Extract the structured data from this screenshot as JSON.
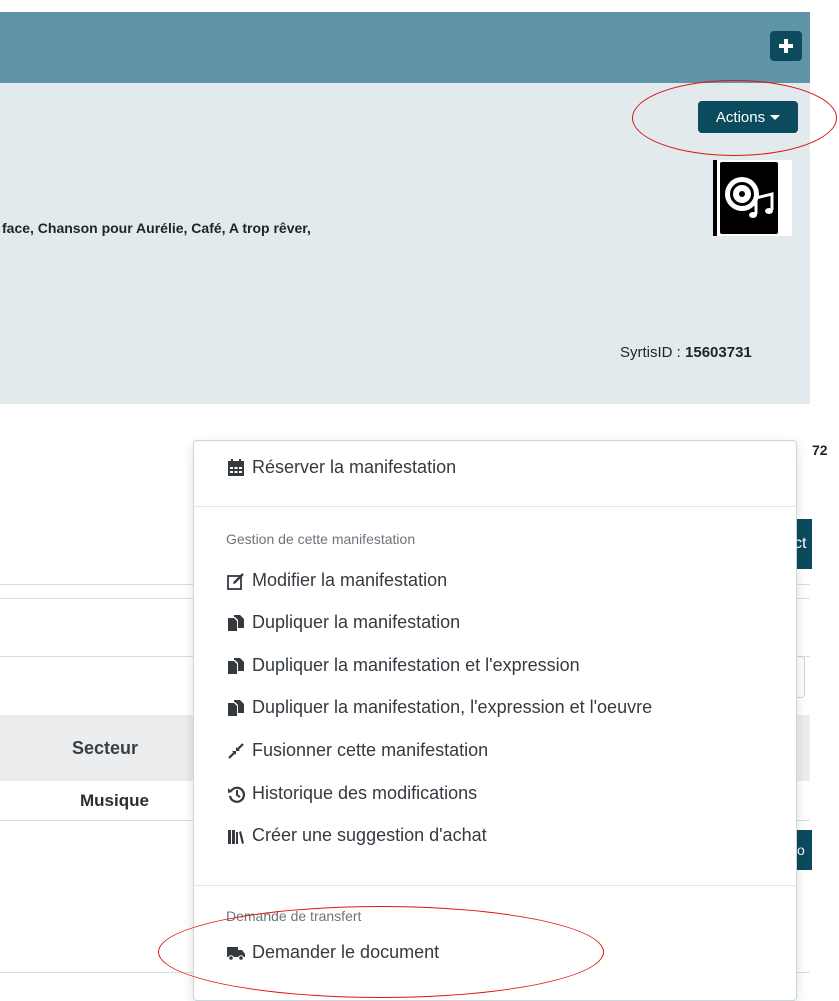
{
  "header": {
    "add_icon": "plus-icon",
    "actions_label": "Actions"
  },
  "record": {
    "tracks": "face,  Chanson pour Aurélie,  Café,  A trop rêver,",
    "syrtis_label": "SyrtisID : ",
    "syrtis_id": "15603731",
    "thumbnail_icon": "cd-music-icon"
  },
  "background": {
    "edge_text": "72",
    "tab1_text": "ct",
    "tab2_text": "tio",
    "table_header": "Secteur",
    "table_value": "Musique"
  },
  "dropdown": {
    "reserve": {
      "icon": "calendar-icon",
      "label": "Réserver la manifestation"
    },
    "section_manage": "Gestion de cette manifestation",
    "items": [
      {
        "icon": "edit-icon",
        "label": "Modifier la manifestation"
      },
      {
        "icon": "copy-icon",
        "label": "Dupliquer la manifestation"
      },
      {
        "icon": "copy-icon",
        "label": "Dupliquer la manifestation et l'expression"
      },
      {
        "icon": "copy-icon",
        "label": "Dupliquer la manifestation, l'expression et l'oeuvre"
      },
      {
        "icon": "merge-icon",
        "label": "Fusionner cette manifestation"
      },
      {
        "icon": "history-icon",
        "label": "Historique des modifications"
      },
      {
        "icon": "books-icon",
        "label": "Créer une suggestion d'achat"
      }
    ],
    "section_transfer": "Demande de transfert",
    "transfer": {
      "icon": "truck-icon",
      "label": "Demander le document"
    }
  },
  "colors": {
    "header_bar": "#5f93a8",
    "button_dark": "#0c4b5e",
    "panel_bg": "#e3eaed",
    "annotation_red": "#e11414"
  }
}
